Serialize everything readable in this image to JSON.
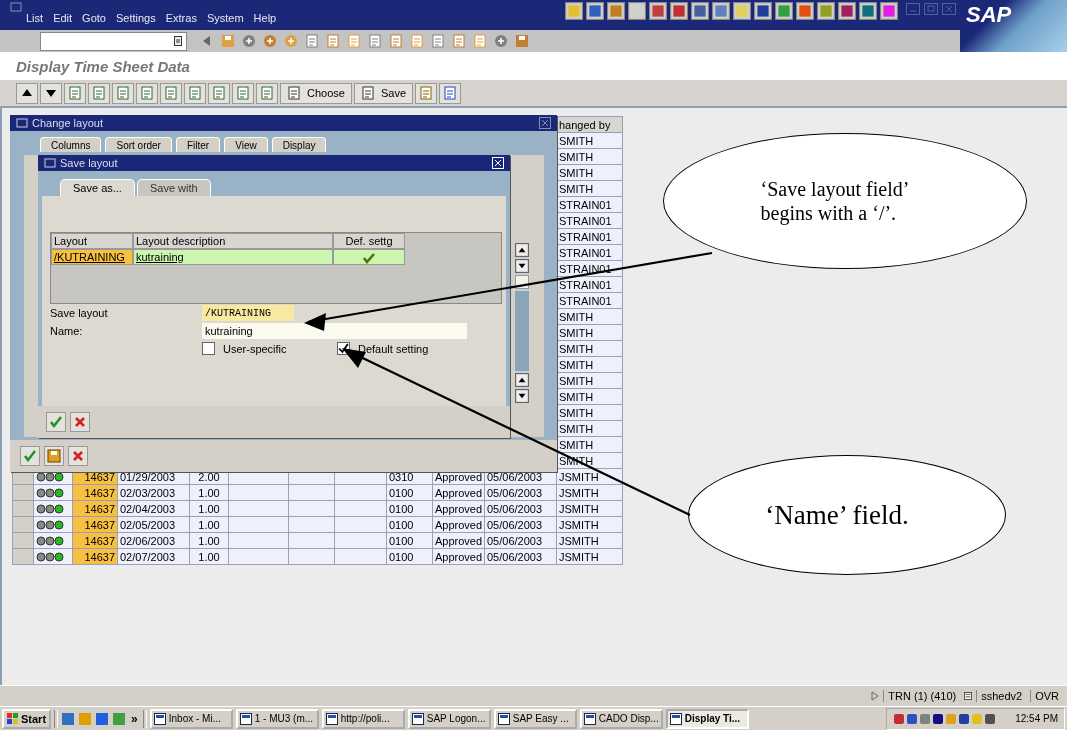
{
  "menu_bar": {
    "items": [
      "List",
      "Edit",
      "Goto",
      "Settings",
      "Extras",
      "System",
      "Help"
    ],
    "logo": "SAP"
  },
  "screen_title": "Display Time Sheet Data",
  "application_toolbar": {
    "text_buttons": [
      "Choose",
      "Save"
    ]
  },
  "grid": {
    "changed_by_header": "hanged by",
    "rows": [
      {
        "changed_by": "SMITH"
      },
      {
        "changed_by": "SMITH"
      },
      {
        "changed_by": "SMITH"
      },
      {
        "changed_by": "SMITH"
      },
      {
        "changed_by": "STRAIN01"
      },
      {
        "changed_by": "STRAIN01"
      },
      {
        "changed_by": "STRAIN01"
      },
      {
        "changed_by": "STRAIN01"
      },
      {
        "changed_by": "STRAIN01"
      },
      {
        "changed_by": "STRAIN01"
      },
      {
        "changed_by": "STRAIN01"
      },
      {
        "changed_by": "SMITH"
      },
      {
        "changed_by": "SMITH"
      },
      {
        "changed_by": "SMITH"
      },
      {
        "changed_by": "SMITH"
      },
      {
        "changed_by": "SMITH"
      },
      {
        "changed_by": "SMITH"
      },
      {
        "changed_by": "SMITH"
      },
      {
        "changed_by": "SMITH"
      },
      {
        "changed_by": "SMITH"
      },
      {
        "changed_by": "SMITH"
      },
      {
        "column_3": "14637",
        "column_4": "01/29/2003",
        "column_5": "2.00",
        "column_9": "0310",
        "column_10": "Approved",
        "column_11": "05/06/2003",
        "changed_by": "JSMITH"
      },
      {
        "column_3": "14637",
        "column_4": "02/03/2003",
        "column_5": "1.00",
        "column_9": "0100",
        "column_10": "Approved",
        "column_11": "05/06/2003",
        "changed_by": "JSMITH"
      },
      {
        "column_3": "14637",
        "column_4": "02/04/2003",
        "column_5": "1.00",
        "column_9": "0100",
        "column_10": "Approved",
        "column_11": "05/06/2003",
        "changed_by": "JSMITH"
      },
      {
        "column_3": "14637",
        "column_4": "02/05/2003",
        "column_5": "1.00",
        "column_9": "0100",
        "column_10": "Approved",
        "column_11": "05/06/2003",
        "changed_by": "JSMITH"
      },
      {
        "column_3": "14637",
        "column_4": "02/06/2003",
        "column_5": "1.00",
        "column_9": "0100",
        "column_10": "Approved",
        "column_11": "05/06/2003",
        "changed_by": "JSMITH"
      },
      {
        "column_3": "14637",
        "column_4": "02/07/2003",
        "column_5": "1.00",
        "column_9": "0100",
        "column_10": "Approved",
        "column_11": "05/06/2003",
        "changed_by": "JSMITH"
      }
    ]
  },
  "change_layout": {
    "title": "Change layout",
    "tabs": [
      "Columns",
      "Sort order",
      "Filter",
      "View",
      "Display"
    ]
  },
  "save_layout": {
    "title": "Save layout",
    "tabs": [
      {
        "label": "Save as...",
        "selected": true
      },
      {
        "label": "Save with",
        "selected": false
      }
    ],
    "table": {
      "columns": [
        "Layout",
        "Layout description",
        "Def. settg"
      ],
      "rows": [
        {
          "layout": "/KUTRAINING",
          "description": "kutraining",
          "default_setting": true
        }
      ]
    },
    "fields": [
      {
        "label": "Save layout",
        "value": "/KUTRAINING",
        "kind": "key"
      },
      {
        "label": "Name:",
        "value": "kutraining",
        "kind": "text"
      }
    ],
    "checkboxes": [
      {
        "label": "User-specific",
        "checked": false
      },
      {
        "label": "Default setting",
        "checked": true
      }
    ]
  },
  "callouts": [
    {
      "lines": [
        "‘Save layout field’",
        "begins with a ‘/’."
      ]
    },
    {
      "lines": [
        "‘Name’ field."
      ]
    }
  ],
  "status_bar": {
    "system": "TRN (1) (410)",
    "server": "sshedv2",
    "mode": "OVR"
  },
  "taskbar": {
    "start": "Start",
    "more": "»",
    "items": [
      {
        "label": "Inbox - Mi...",
        "selected": false
      },
      {
        "label": "1 - MU3 (m...",
        "selected": false
      },
      {
        "label": "http://poli...",
        "selected": false
      },
      {
        "label": "SAP Logon...",
        "selected": false
      },
      {
        "label": "SAP Easy ...",
        "selected": false
      },
      {
        "label": "CADO Disp...",
        "selected": false
      },
      {
        "label": "Display Ti...",
        "selected": true
      }
    ],
    "clock": "12:54 PM"
  }
}
